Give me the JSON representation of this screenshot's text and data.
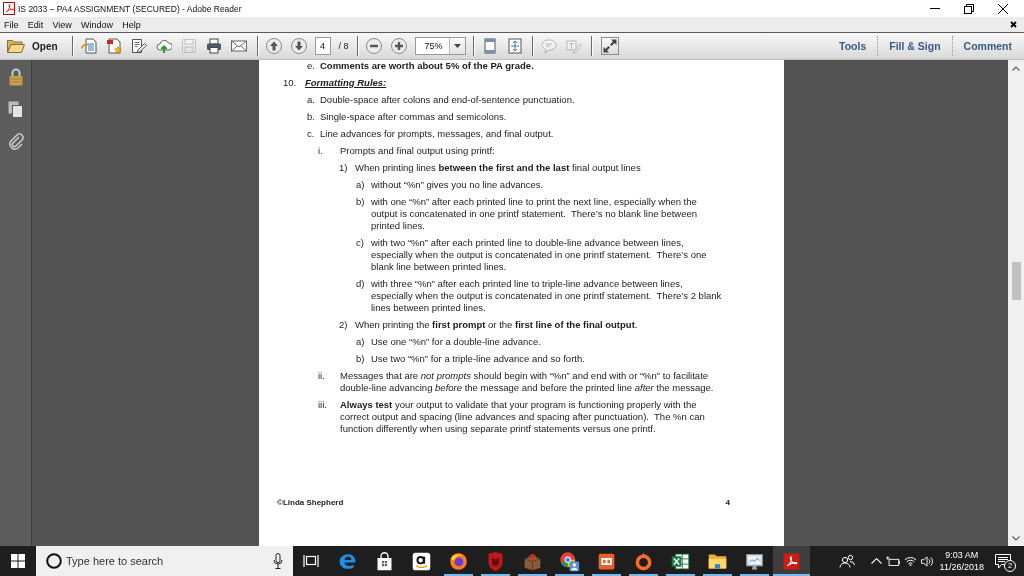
{
  "window": {
    "title": "IS 2033 – PA4 ASSIGNMENT (SECURED) - Adobe Reader"
  },
  "menu": [
    "File",
    "Edit",
    "View",
    "Window",
    "Help"
  ],
  "toolbar": {
    "open_label": "Open",
    "groups": [
      {
        "buttons": [
          {
            "disabled": false
          },
          {
            "disabled": false
          },
          {
            "disabled": false
          },
          {
            "disabled": false
          },
          {
            "disabled": true
          },
          {
            "disabled": false
          },
          {
            "disabled": false
          }
        ]
      },
      {
        "buttons": [
          {
            "disabled": false
          },
          {
            "disabled": false
          }
        ]
      },
      {
        "buttons": [
          {
            "disabled": true
          },
          {
            "disabled": true
          }
        ]
      },
      {
        "buttons": [
          {
            "disabled": false
          }
        ]
      }
    ],
    "page": {
      "value": "4",
      "total": "/ 8"
    },
    "zoom": {
      "value": "75%"
    },
    "panes": [
      {
        "label": "Tools"
      },
      {
        "label": "Fill & Sign"
      },
      {
        "label": "Comment"
      }
    ]
  },
  "document": {
    "continued_items": [
      {
        "marker": "e.",
        "lines": [
          "Comments are worth about 5% of the PA grade."
        ]
      }
    ],
    "outline": [
      {
        "marker": "10.",
        "title": "Formatting Rules:",
        "children": [
          {
            "marker": "a.",
            "lines": [
              "Double-space after colons and end-of-sentence punctuation."
            ]
          },
          {
            "marker": "b.",
            "lines": [
              "Single-space after commas and semicolons."
            ]
          },
          {
            "marker": "c.",
            "lines": [
              "Line advances for prompts, messages, and final output."
            ],
            "children": [
              {
                "marker": "i.",
                "lines": [
                  "Prompts and final output using printf:"
                ],
                "children": [
                  {
                    "marker": "1)",
                    "lines": [
                      "When printing lines **between the first and the last** final output lines"
                    ],
                    "children": [
                      {
                        "marker": "a)",
                        "lines": [
                          "without “%n” gives you no line advances."
                        ]
                      },
                      {
                        "marker": "b)",
                        "lines": [
                          "with one “%n” after each printed line to print the next line, especially when the",
                          "output is concatenated in one printf statement.  There’s no blank line between",
                          "printed lines."
                        ]
                      },
                      {
                        "marker": "c)",
                        "lines": [
                          "with two “%n” after each printed line to double-line advance between lines,",
                          "especially when the output is concatenated in one printf statement.  There’s one",
                          "blank line between printed lines."
                        ]
                      },
                      {
                        "marker": "d)",
                        "lines": [
                          "with three “%n” after each printed line to triple-line advance between lines,",
                          "especially when the output is concatenated in one printf statement.  There’s 2 blank",
                          "lines between printed lines."
                        ]
                      }
                    ]
                  },
                  {
                    "marker": "2)",
                    "lines": [
                      "When printing the **first prompt** or the **first line of the final output**."
                    ],
                    "children": [
                      {
                        "marker": "a)",
                        "lines": [
                          "Use one “%n” for a double-line advance."
                        ]
                      },
                      {
                        "marker": "b)",
                        "lines": [
                          "Use two “%n” for a triple-line advance and so forth."
                        ]
                      }
                    ]
                  }
                ]
              },
              {
                "marker": "ii.",
                "lines": [
                  "Messages that are *not prompts* should begin with “%n” and end with or “%n” to facilitate",
                  "double-line advancing *before* the message and before the printed line *after* the message."
                ]
              },
              {
                "marker": "iii.",
                "lines": [
                  "**Always test** your output to validate that your program is functioning properly with the",
                  "correct output and spacing (line advances and spacing after punctuation).  The %n can",
                  "function differently when using separate printf statements versus one printf."
                ]
              }
            ]
          }
        ]
      }
    ],
    "footer": {
      "author": "©Linda Shepherd",
      "page_number": "4"
    }
  },
  "taskbar": {
    "search": {
      "placeholder": "Type here to search"
    },
    "apps": [
      {
        "running": false,
        "selected": false
      },
      {
        "running": false,
        "selected": false
      },
      {
        "running": false,
        "selected": false
      },
      {
        "running": true,
        "selected": false
      },
      {
        "running": true,
        "selected": false
      },
      {
        "running": true,
        "selected": false
      },
      {
        "running": true,
        "selected": false
      },
      {
        "running": true,
        "selected": false
      },
      {
        "running": true,
        "selected": false
      },
      {
        "running": true,
        "selected": false
      },
      {
        "running": true,
        "selected": false
      },
      {
        "running": true,
        "selected": false
      },
      {
        "running": true,
        "selected": true
      }
    ],
    "clock": {
      "time": "9:03 AM",
      "date": "11/26/2018"
    },
    "notification_count": "2"
  }
}
